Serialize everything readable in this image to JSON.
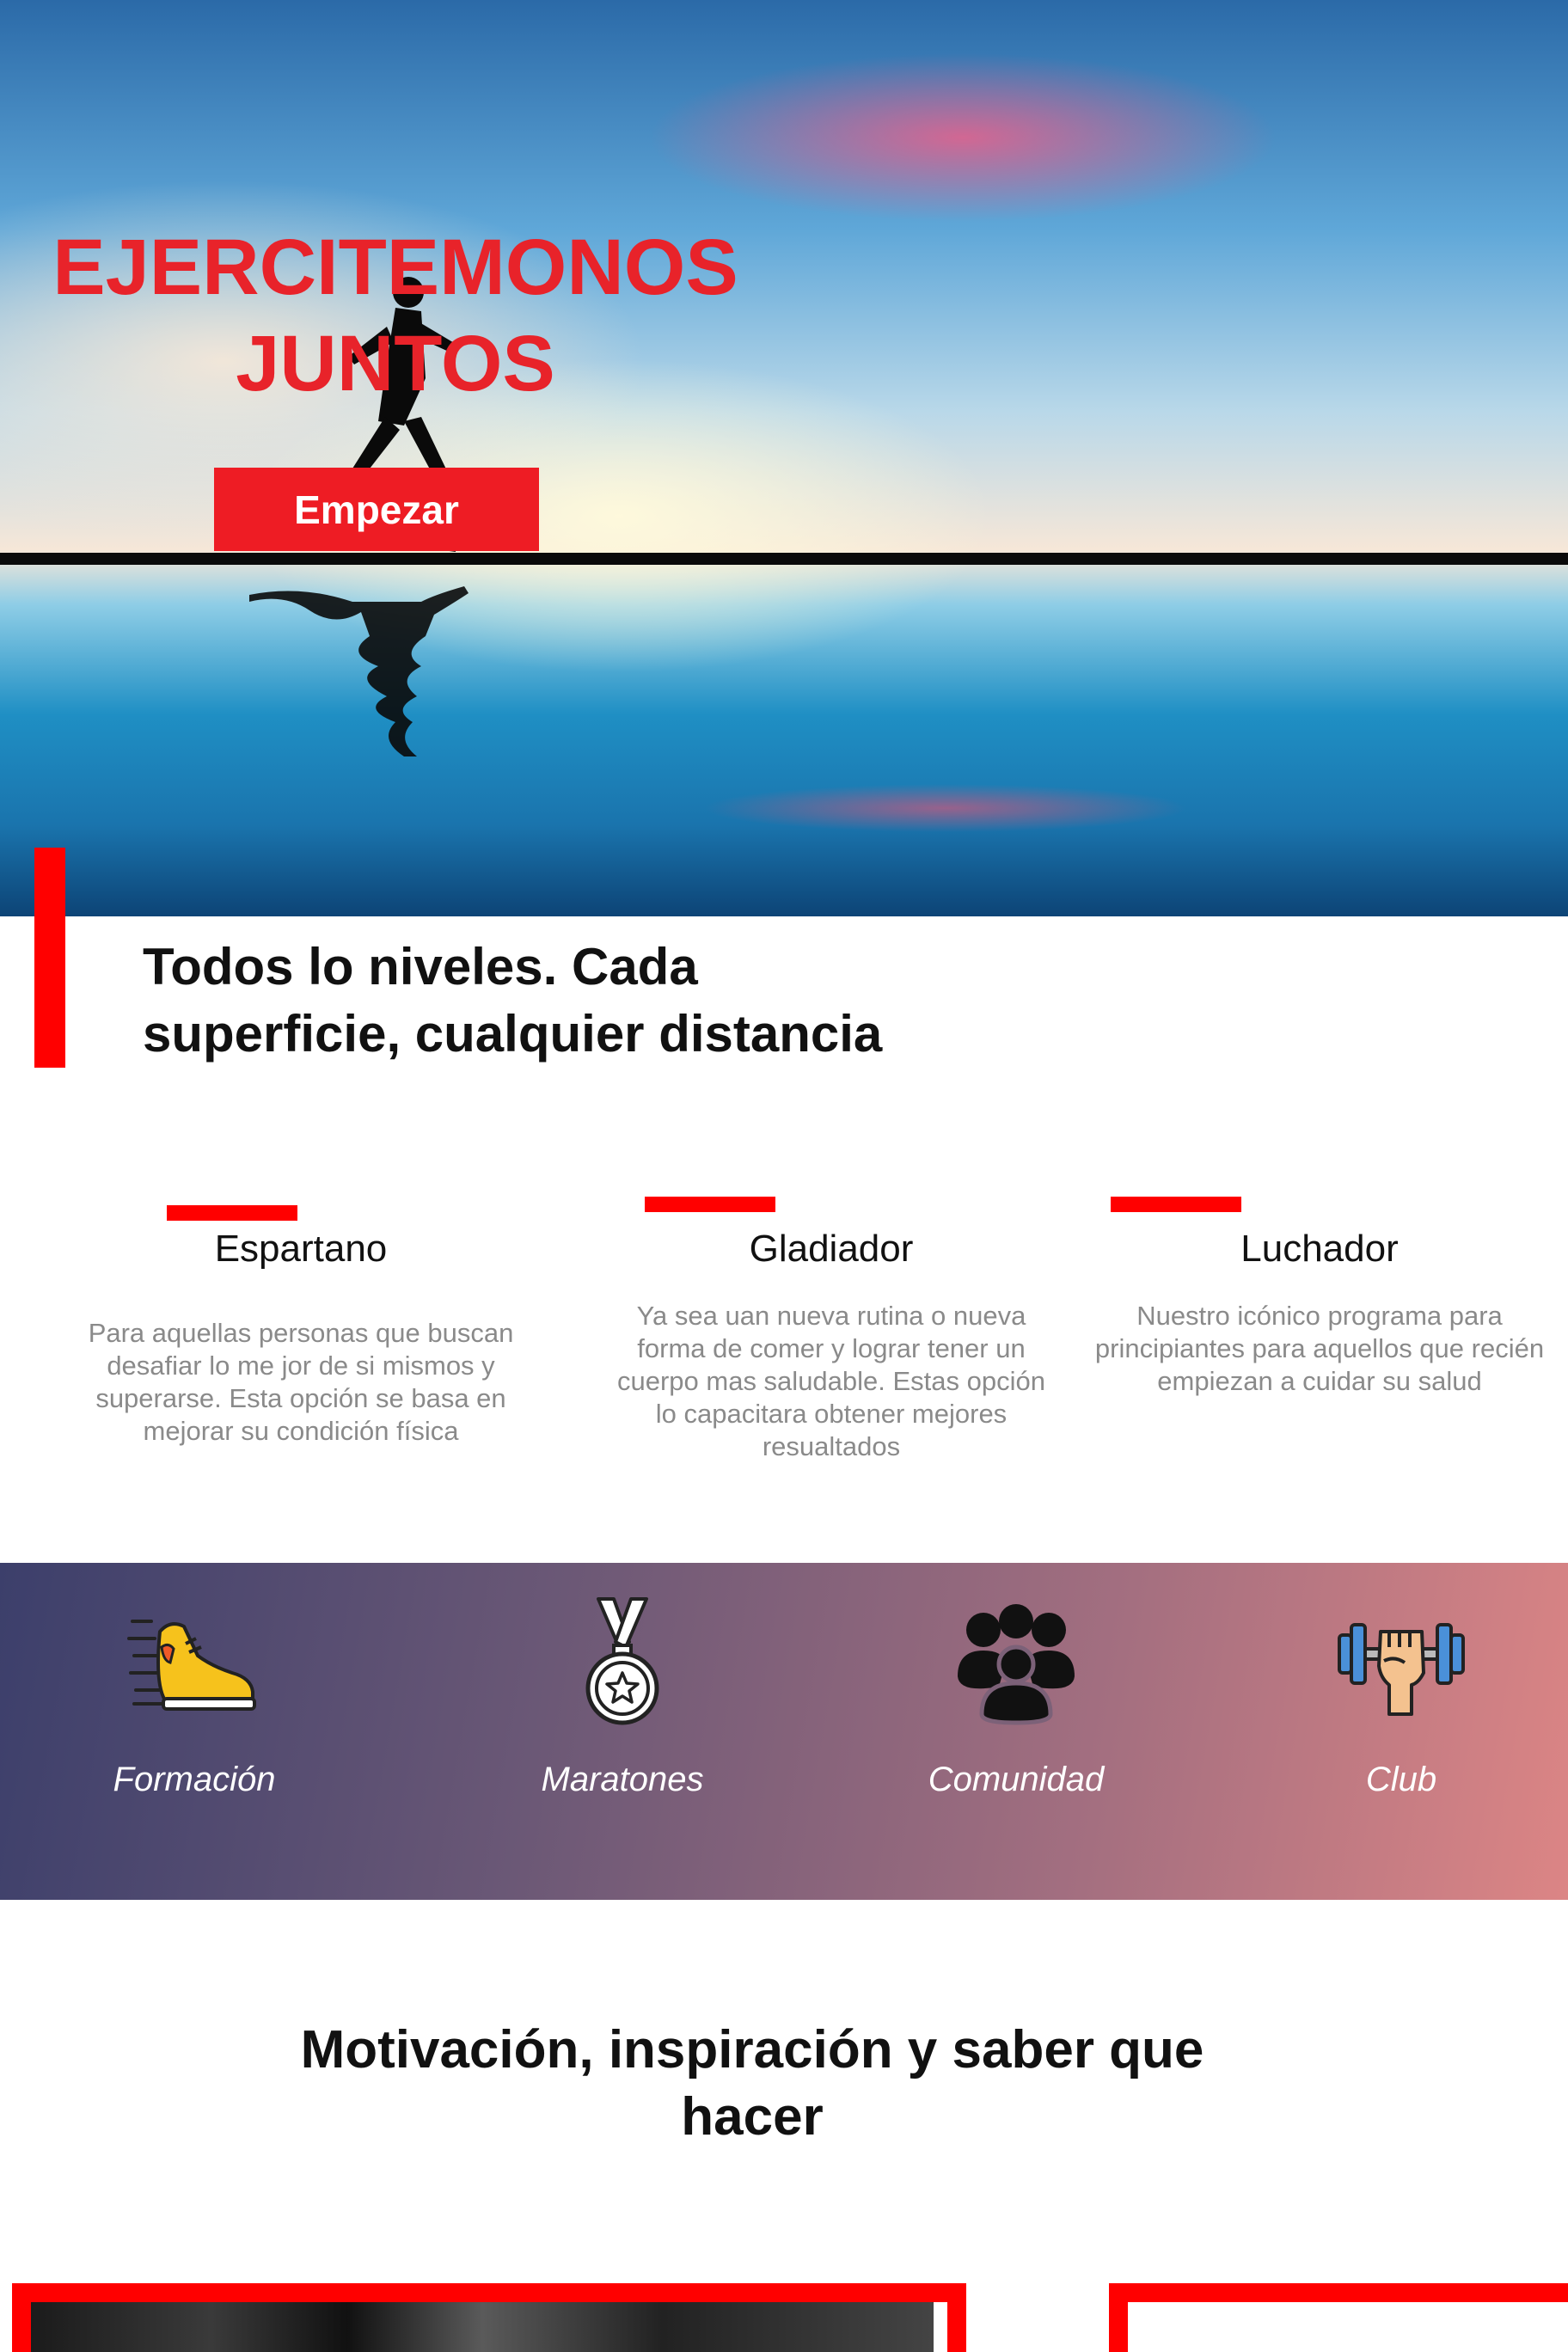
{
  "hero": {
    "title_line1": "EJERCITEMONOS",
    "title_line2": "JUNTOS",
    "cta_label": "Empezar"
  },
  "levels": {
    "heading_line1": "Todos lo niveles. Cada",
    "heading_line2": "superficie, cualquier distancia"
  },
  "programs": [
    {
      "title": "Espartano",
      "description": "Para aquellas personas que buscan desafiar lo me jor de si mismos y superarse. Esta opción se basa en mejorar su condición física"
    },
    {
      "title": "Gladiador",
      "description": "Ya sea uan nueva rutina o nueva forma de comer y lograr tener un cuerpo mas saludable. Estas opción lo capacitara obtener mejores resualtados"
    },
    {
      "title": "Luchador",
      "description": "Nuestro icónico programa para principiantes para aquellos que recién empiezan a cuidar su salud"
    }
  ],
  "features": [
    {
      "label": "Formación",
      "icon": "running-shoe-icon"
    },
    {
      "label": "Maratones",
      "icon": "medal-icon"
    },
    {
      "label": "Comunidad",
      "icon": "community-icon"
    },
    {
      "label": "Club",
      "icon": "dumbbell-fist-icon"
    }
  ],
  "motivation": {
    "heading_line1": "Motivación, inspiración y saber que",
    "heading_line2": "hacer"
  },
  "colors": {
    "accent_red": "#ff0000",
    "hero_title_red": "#e8232a",
    "band_start": "#3c3f6b",
    "band_end": "#dc8585"
  }
}
